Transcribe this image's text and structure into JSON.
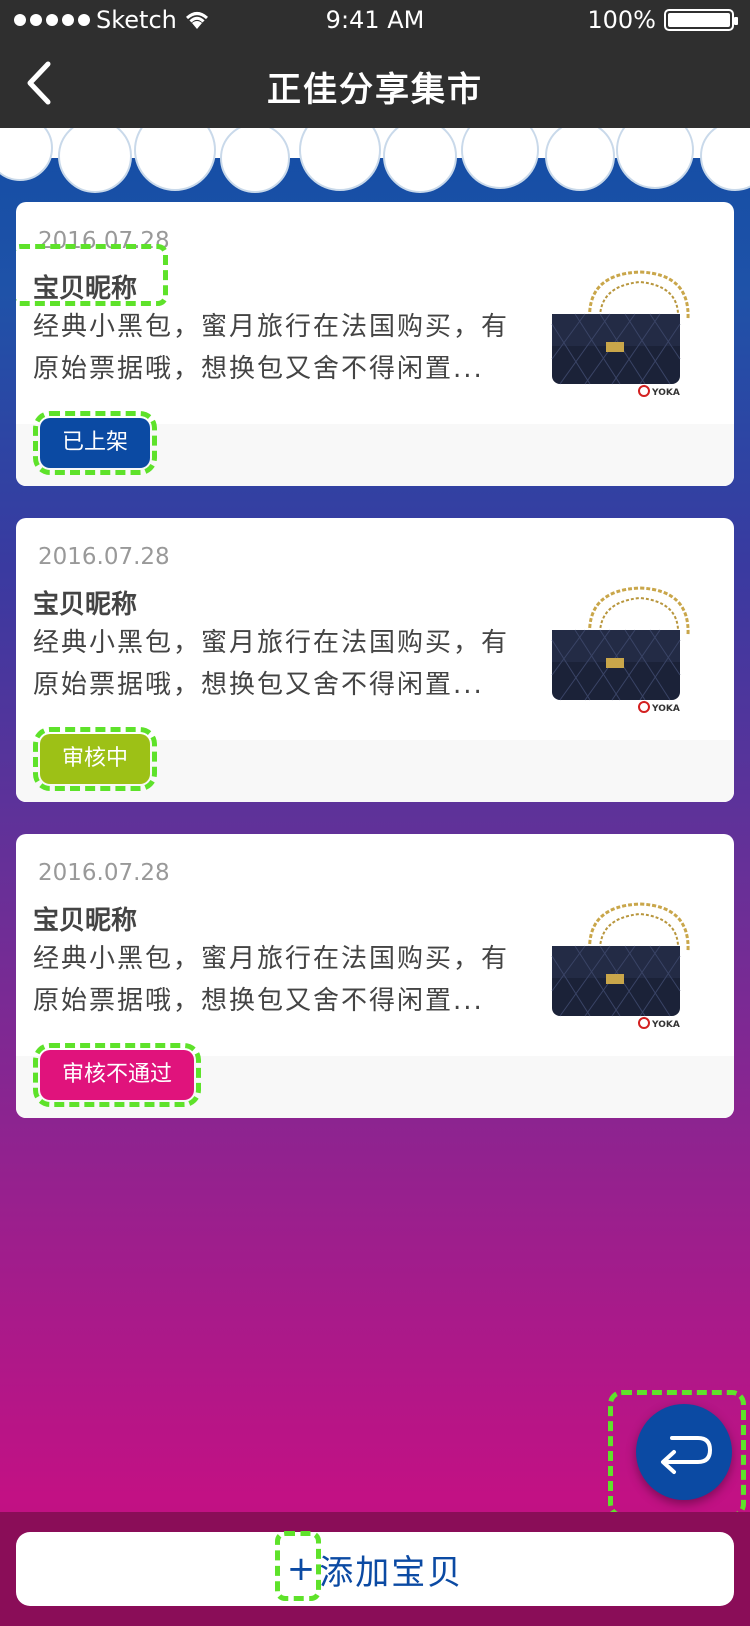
{
  "status_bar": {
    "carrier": "Sketch",
    "time": "9:41 AM",
    "battery": "100%"
  },
  "nav": {
    "title": "正佳分享集市",
    "back_icon": "chevron-left-icon"
  },
  "items": [
    {
      "date": "2016.07.28",
      "name": "宝贝昵称",
      "description_line1": "经典小黑包，蜜月旅行在法国购买，有",
      "description_line2": "原始票据哦，想换包又舍不得闲置...",
      "status": "已上架",
      "status_color": "#0b4aa3",
      "image": "handbag-image",
      "image_logo": "YOKA"
    },
    {
      "date": "2016.07.28",
      "name": "宝贝昵称",
      "description_line1": "经典小黑包，蜜月旅行在法国购买，有",
      "description_line2": "原始票据哦，想换包又舍不得闲置...",
      "status": "审核中",
      "status_color": "#9dc116",
      "image": "handbag-image",
      "image_logo": "YOKA"
    },
    {
      "date": "2016.07.28",
      "name": "宝贝昵称",
      "description_line1": "经典小黑包，蜜月旅行在法国购买，有",
      "description_line2": "原始票据哦，想换包又舍不得闲置...",
      "status": "审核不通过",
      "status_color": "#e0137c",
      "image": "handbag-image",
      "image_logo": "YOKA"
    }
  ],
  "fab": {
    "icon": "return-arrow-icon"
  },
  "bottom": {
    "add_icon": "plus-icon",
    "add_icon_glyph": "+",
    "add_label": "添加宝贝"
  },
  "colors": {
    "primary": "#0b4aa3",
    "nav_background": "#2f2f2f",
    "highlight": "#5ee22a"
  }
}
